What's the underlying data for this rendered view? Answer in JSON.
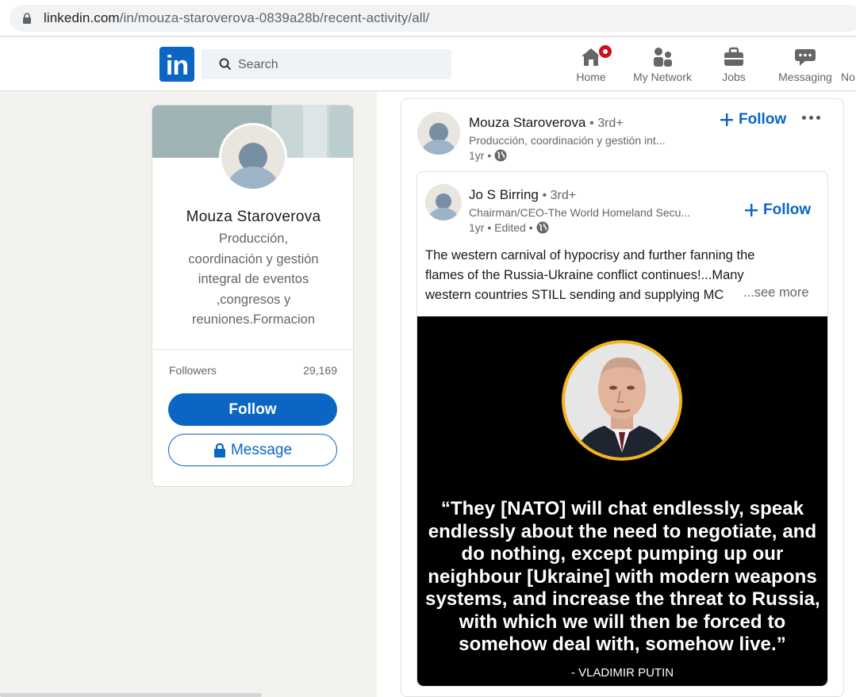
{
  "browser": {
    "url_host": "linkedin.com",
    "url_path": "/in/mouza-staroverova-0839a28b/recent-activity/all/"
  },
  "nav": {
    "logo_text": "in",
    "search_placeholder": "Search",
    "items": [
      {
        "label": "Home",
        "icon": "home-icon",
        "has_badge": true
      },
      {
        "label": "My Network",
        "icon": "network-icon"
      },
      {
        "label": "Jobs",
        "icon": "briefcase-icon"
      },
      {
        "label": "Messaging",
        "icon": "messaging-icon"
      },
      {
        "label": "No",
        "icon": "bell-icon"
      }
    ]
  },
  "profile": {
    "name": "Mouza Staroverova",
    "headline": "Producción, coordinación y gestión integral de eventos ,congresos y reuniones.Formacion",
    "headline_lines": [
      "Producción,",
      "coordinación y gestión",
      "integral de eventos",
      ",congresos y",
      "reuniones.Formacion"
    ],
    "followers_label": "Followers",
    "followers_count": "29,169",
    "follow_label": "Follow",
    "message_label": "Message"
  },
  "post": {
    "actor": {
      "name": "Mouza Staroverova",
      "degree": "• 3rd+",
      "subtitle": "Producción, coordinación y gestión int...",
      "time": "1yr •"
    },
    "follow_label": "Follow",
    "shared": {
      "actor": {
        "name": "Jo S Birring",
        "degree": "• 3rd+",
        "subtitle": "Chairman/CEO-The World Homeland Secu...",
        "time": "1yr • Edited •"
      },
      "follow_label": "Follow",
      "text_lines": [
        "The western carnival of hypocrisy and further fanning the",
        "flames of the Russia-Ukraine conflict continues!...Many",
        "western countries STILL sending and supplying MC"
      ],
      "see_more": "...see more",
      "image": {
        "quote_lines": [
          "“They [NATO] will chat endlessly, speak",
          "endlessly about the need to negotiate, and",
          "do nothing, except pumping up our",
          "neighbour [Ukraine] with modern weapons",
          "systems, and increase the threat to Russia,",
          "with which we will then be forced to",
          "somehow deal with, somehow live.”"
        ],
        "attribution": "- VLADIMIR PUTIN",
        "ring_color": "#f3b51c"
      }
    }
  },
  "colors": {
    "brand": "#0a66c2",
    "badge": "#cc1016",
    "page_bg": "#f3f2ef"
  }
}
